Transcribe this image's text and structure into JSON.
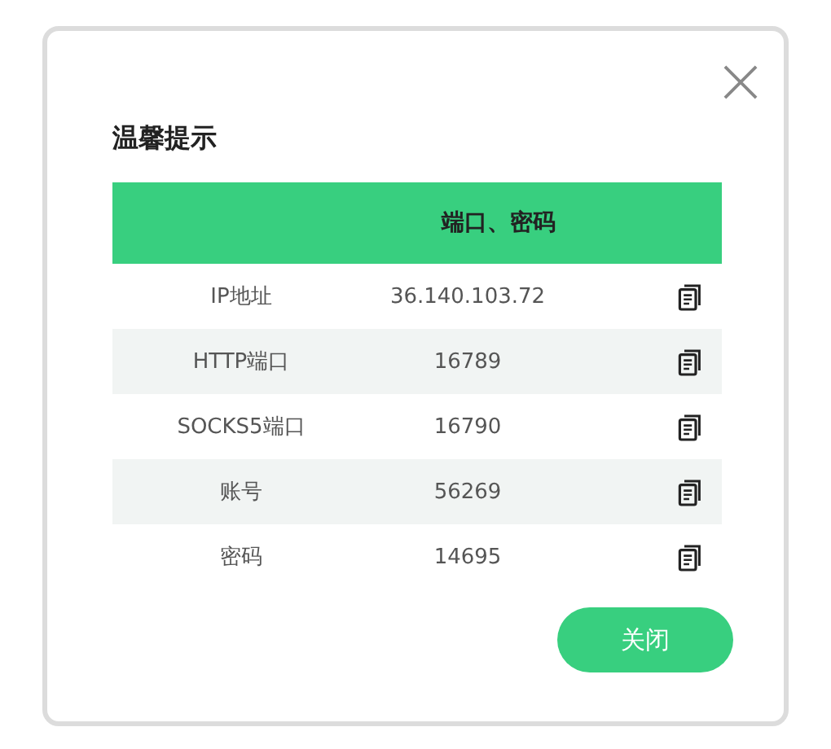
{
  "dialog": {
    "title": "温馨提示",
    "table": {
      "header": "端口、密码",
      "rows": [
        {
          "label": "IP地址",
          "value": "36.140.103.72"
        },
        {
          "label": "HTTP端口",
          "value": "16789"
        },
        {
          "label": "SOCKS5端口",
          "value": "16790"
        },
        {
          "label": "账号",
          "value": "56269"
        },
        {
          "label": "密码",
          "value": "14695"
        }
      ]
    },
    "button": "关闭"
  }
}
